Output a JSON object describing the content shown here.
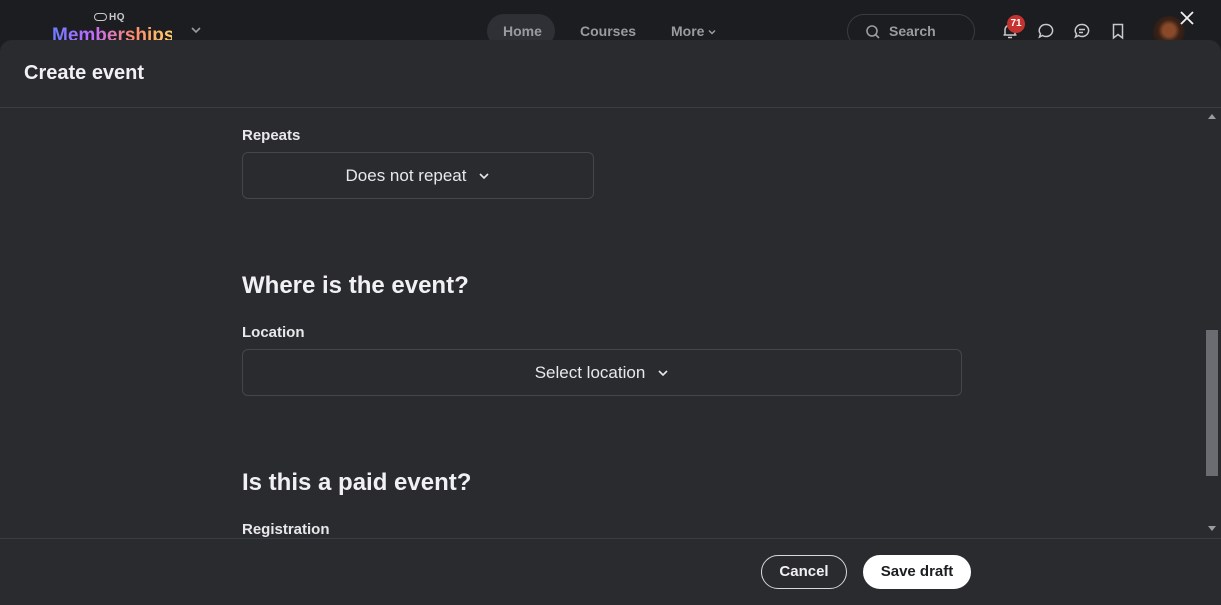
{
  "topbar": {
    "logo_small": "HQ",
    "logo_big": "Memberships",
    "nav": {
      "home": "Home",
      "courses": "Courses",
      "more": "More"
    },
    "search_label": "Search",
    "notification_count": "71"
  },
  "modal": {
    "title": "Create event",
    "repeats": {
      "label": "Repeats",
      "value": "Does not repeat"
    },
    "where_section": "Where is the event?",
    "location": {
      "label": "Location",
      "placeholder": "Select location"
    },
    "paid_section": "Is this a paid event?",
    "registration_label": "Registration",
    "footer": {
      "cancel_label": "Cancel",
      "save_label": "Save draft"
    }
  },
  "colors": {
    "background": "#2a2b2f",
    "badge": "#c4332f",
    "primary_button": "#ffffff"
  }
}
